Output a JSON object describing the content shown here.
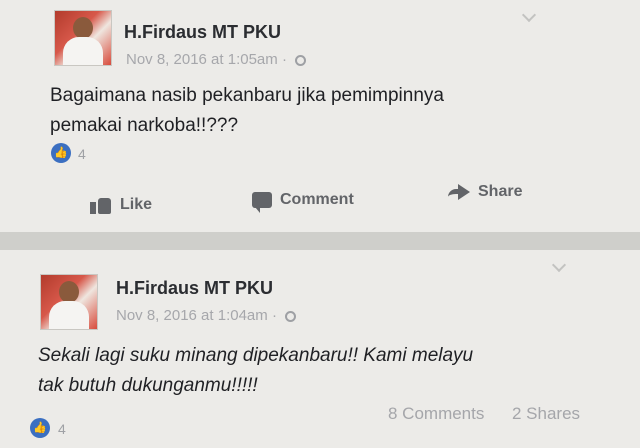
{
  "posts": [
    {
      "author": "H.Firdaus MT PKU",
      "timestamp": "Nov 8, 2016 at 1:05am",
      "privacy_separator": "·",
      "text_line1": "Bagaimana nasib pekanbaru jika pemimpinnya",
      "text_line2": "pemakai narkoba!!???",
      "like_count": "4",
      "actions": {
        "like": "Like",
        "comment": "Comment",
        "share": "Share"
      }
    },
    {
      "author": "H.Firdaus MT PKU",
      "timestamp": "Nov 8, 2016 at 1:04am",
      "privacy_separator": "·",
      "text_line1": "Sekali lagi suku minang dipekanbaru!!  Kami melayu",
      "text_line2": "tak butuh dukunganmu!!!!!",
      "like_count": "4",
      "comments": "8 Comments",
      "shares": "2 Shares"
    }
  ],
  "icons": {
    "like_badge": "thumbs-up-icon",
    "privacy": "globe-icon",
    "menu": "chevron-down-icon",
    "like": "thumbs-up-icon",
    "comment": "speech-bubble-icon",
    "share": "share-arrow-icon"
  },
  "colors": {
    "accent": "#3b6fc1",
    "meta_gray": "#a6a7ab",
    "action_gray": "#626468"
  }
}
